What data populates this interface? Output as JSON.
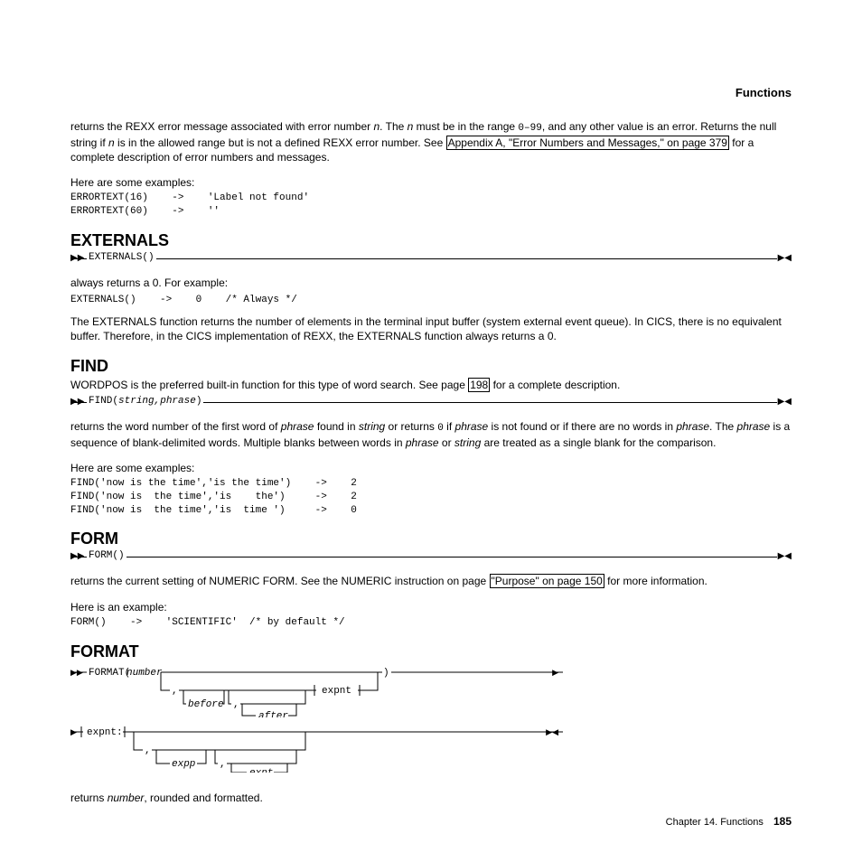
{
  "header": "Functions",
  "intro": {
    "p1a": "returns the REXX error message associated with error number ",
    "p1_n1": "n",
    "p1b": ". The ",
    "p1_n2": "n",
    "p1c": " must be in the range ",
    "p1_code": "0–99",
    "p1d": ", and any other value is an error. Returns the null string if ",
    "p1_n3": "n",
    "p1e": " is in the allowed range but is not a defined REXX error number. See ",
    "link": "Appendix A, \"Error Numbers and Messages,\" on page 379",
    "p1f": " for a complete description of error numbers and messages."
  },
  "examples_lead": "Here are some examples:",
  "errortext_code": "ERRORTEXT(16)    ->    'Label not found'\nERRORTEXT(60)    ->    ''",
  "externals": {
    "title": "EXTERNALS",
    "syntax": "EXTERNALS()",
    "desc1": "always returns a 0. For example:",
    "code": "EXTERNALS()    ->    0    /* Always */",
    "desc2": "The EXTERNALS function returns the number of elements in the terminal input buffer (system external event queue). In CICS, there is no equivalent buffer. Therefore, in the CICS implementation of REXX, the EXTERNALS function always returns a 0."
  },
  "find": {
    "title": "FIND",
    "desc1a": "WORDPOS is the preferred built-in function for this type of word search. See page ",
    "desc1_link": "198",
    "desc1b": " for a complete description.",
    "syntax_pre": "FIND(",
    "syntax_args": "string,phrase",
    "syntax_post": ")",
    "desc2a": "returns the word number of the first word of ",
    "desc2_i1": "phrase",
    "desc2b": " found in ",
    "desc2_i2": "string",
    "desc2c": " or returns ",
    "desc2_code": "0",
    "desc2d": " if ",
    "desc2_i3": "phrase",
    "desc2e": " is not found or if there are no words in ",
    "desc2_i4": "phrase",
    "desc2f": ". The ",
    "desc2_i5": "phrase",
    "desc2g": " is a sequence of blank-delimited words. Multiple blanks between words in ",
    "desc2_i6": "phrase",
    "desc2h": " or ",
    "desc2_i7": "string",
    "desc2i": " are treated as a single blank for the comparison.",
    "code": "FIND('now is the time','is the time')    ->    2\nFIND('now is  the time','is    the')     ->    2\nFIND('now is  the time','is  time ')     ->    0"
  },
  "form": {
    "title": "FORM",
    "syntax": "FORM()",
    "desc1a": "returns the current setting of NUMERIC FORM. See the NUMERIC instruction on page ",
    "desc1_link": "\"Purpose\" on page 150",
    "desc1b": " for more information.",
    "example_lead": "Here is an example:",
    "code": "FORM()    ->    'SCIENTIFIC'  /* by default */"
  },
  "format": {
    "title": "FORMAT",
    "desc": "returns ",
    "desc_i": "number",
    "desc_b": ", rounded and formatted."
  },
  "syntax_labels": {
    "format_fn": "FORMAT(",
    "number": "number",
    "before": "before",
    "after": "after",
    "expnt": "expnt",
    "expnt_label": "expnt:",
    "expp": "expp",
    "expt": "expt"
  },
  "footer": {
    "chapter": "Chapter 14. Functions",
    "page": "185"
  }
}
